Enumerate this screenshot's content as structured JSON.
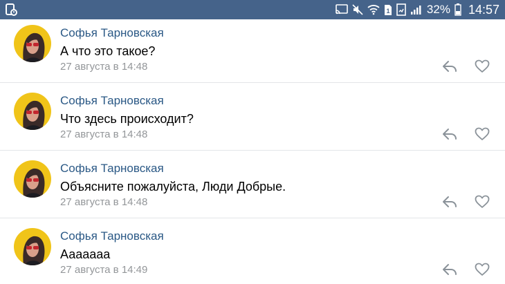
{
  "status_bar": {
    "battery_percent": "32%",
    "time": "14:57",
    "icons": [
      "save-icon",
      "cast-icon",
      "mute-icon",
      "wifi-icon",
      "sim-icon",
      "battery-saver-icon",
      "signal-icon",
      "battery-icon"
    ]
  },
  "comments": [
    {
      "author": "Софья Тарновская",
      "text": "А что это такое?",
      "date": "27 августа в 14:48"
    },
    {
      "author": "Софья Тарновская",
      "text": "Что здесь происходит?",
      "date": "27 августа в 14:48"
    },
    {
      "author": "Софья Тарновская",
      "text": "Объясните пожалуйста, Люди Добрые.",
      "date": "27 августа в 14:48"
    },
    {
      "author": "Софья Тарновская",
      "text": "Аааааaa",
      "date": "27 августа в 14:49"
    }
  ],
  "colors": {
    "status_bar": "#45638a",
    "author": "#2a5885",
    "date": "#939699",
    "icon": "#8a9299",
    "avatar_bg": "#f0c419"
  }
}
